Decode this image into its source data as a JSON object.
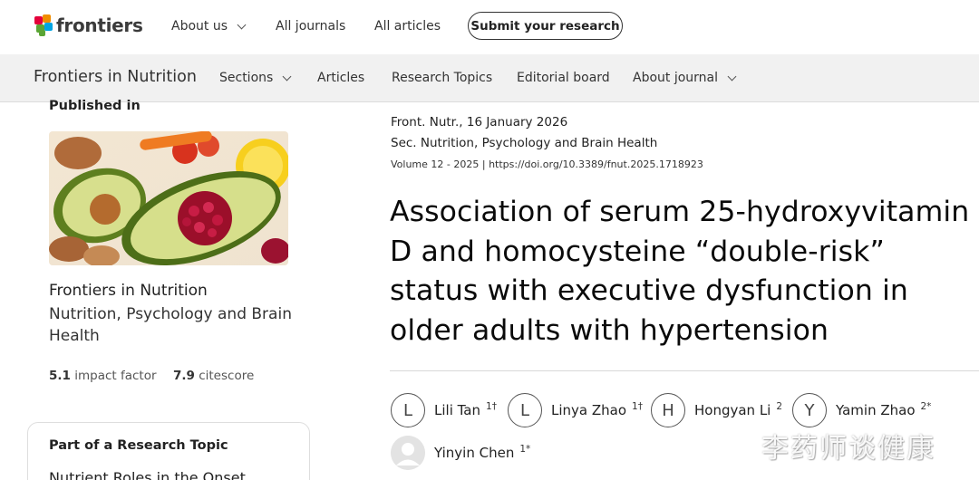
{
  "brand": {
    "name": "frontiers",
    "logo_colors": [
      "#e4003b",
      "#f08d00",
      "#5ba535",
      "#00a5e3"
    ]
  },
  "top_nav": {
    "items": [
      {
        "label": "About us",
        "has_dropdown": true
      },
      {
        "label": "All journals",
        "has_dropdown": false
      },
      {
        "label": "All articles",
        "has_dropdown": false
      }
    ],
    "submit_label": "Submit your research"
  },
  "journal_bar": {
    "journal_name": "Frontiers in Nutrition",
    "items": [
      {
        "label": "Sections",
        "has_dropdown": true
      },
      {
        "label": "Articles",
        "has_dropdown": false
      },
      {
        "label": "Research Topics",
        "has_dropdown": false
      },
      {
        "label": "Editorial board",
        "has_dropdown": false
      },
      {
        "label": "About journal",
        "has_dropdown": true
      }
    ]
  },
  "sidebar": {
    "published_in_label": "Published in",
    "journal": "Frontiers in Nutrition",
    "section": "Nutrition, Psychology and Brain Health",
    "metrics": [
      {
        "value": "5.1",
        "label": "impact factor"
      },
      {
        "value": "7.9",
        "label": "citescore"
      }
    ],
    "research_topic_label": "Part of a Research Topic",
    "research_topic_title": "Nutrient Roles in the Onset"
  },
  "article": {
    "citation": "Front. Nutr., 16 January 2026",
    "section": "Sec. Nutrition, Psychology and Brain Health",
    "volume": "Volume 12 - 2025",
    "doi": "https://doi.org/10.3389/fnut.2025.1718923",
    "title": "Association of serum 25-hydroxyvitamin D and homocysteine “double-risk” status with executive dysfunction in older adults with hypertension"
  },
  "authors": [
    {
      "initial": "L",
      "name": "Lili Tan",
      "affiliation": "1†"
    },
    {
      "initial": "L",
      "name": "Linya Zhao",
      "affiliation": "1†"
    },
    {
      "initial": "H",
      "name": "Hongyan Li",
      "affiliation": "2"
    },
    {
      "initial": "Y",
      "name": "Yamin Zhao",
      "affiliation": "2*"
    },
    {
      "initial": "",
      "name": "Yinyin Chen",
      "affiliation": "1*"
    }
  ],
  "watermark": "李药师谈健康"
}
